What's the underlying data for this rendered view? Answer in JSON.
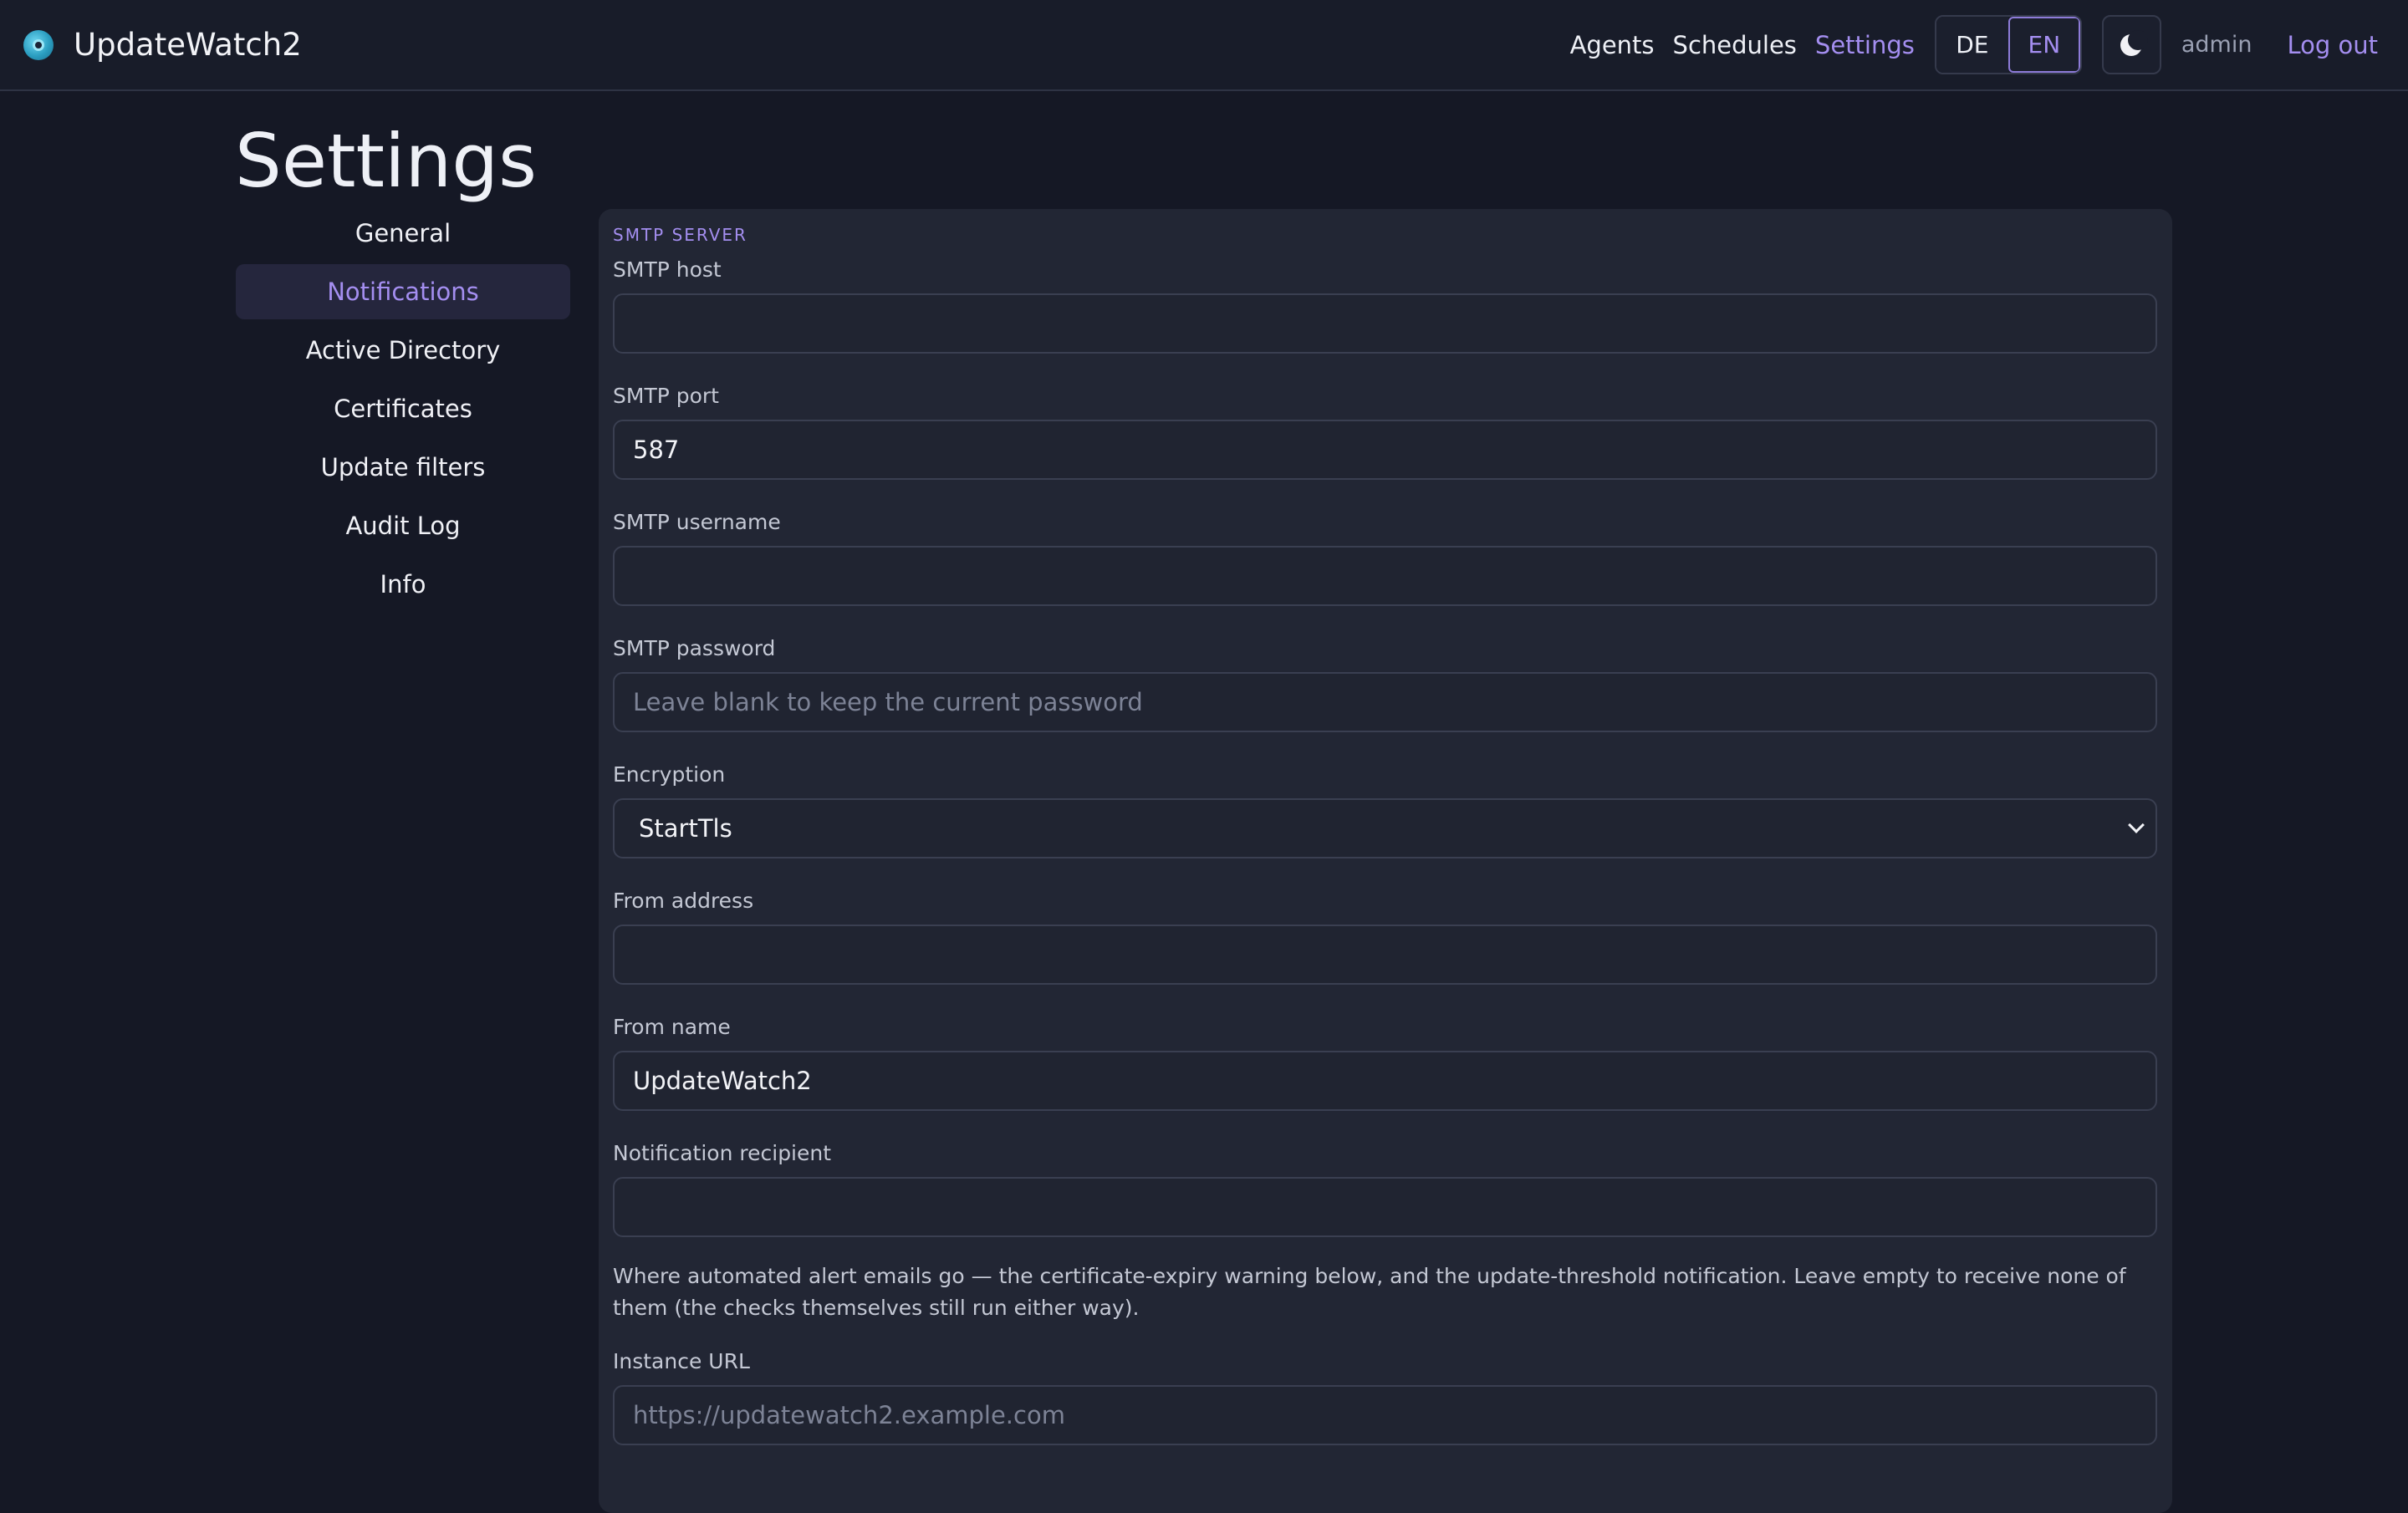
{
  "app": {
    "name": "UpdateWatch2"
  },
  "nav": {
    "links": [
      {
        "label": "Agents",
        "active": false
      },
      {
        "label": "Schedules",
        "active": false
      },
      {
        "label": "Settings",
        "active": true
      }
    ],
    "languages": [
      {
        "label": "DE",
        "active": false
      },
      {
        "label": "EN",
        "active": true
      }
    ],
    "theme_icon": "moon-icon",
    "user": "admin",
    "logout_label": "Log out"
  },
  "page": {
    "title": "Settings"
  },
  "sidebar": {
    "items": [
      {
        "label": "General",
        "active": false
      },
      {
        "label": "Notifications",
        "active": true
      },
      {
        "label": "Active Directory",
        "active": false
      },
      {
        "label": "Certificates",
        "active": false
      },
      {
        "label": "Update filters",
        "active": false
      },
      {
        "label": "Audit Log",
        "active": false
      },
      {
        "label": "Info",
        "active": false
      }
    ]
  },
  "form": {
    "section_label": "SMTP SERVER",
    "smtp_host": {
      "label": "SMTP host",
      "value": "",
      "placeholder": ""
    },
    "smtp_port": {
      "label": "SMTP port",
      "value": "587",
      "placeholder": ""
    },
    "smtp_username": {
      "label": "SMTP username",
      "value": "",
      "placeholder": ""
    },
    "smtp_password": {
      "label": "SMTP password",
      "value": "",
      "placeholder": "Leave blank to keep the current password"
    },
    "encryption": {
      "label": "Encryption",
      "selected": "StartTls"
    },
    "from_address": {
      "label": "From address",
      "value": "",
      "placeholder": ""
    },
    "from_name": {
      "label": "From name",
      "value": "UpdateWatch2",
      "placeholder": ""
    },
    "notification_recipient": {
      "label": "Notification recipient",
      "value": "",
      "placeholder": ""
    },
    "recipient_help": "Where automated alert emails go — the certificate-expiry warning below, and the update-threshold notification. Leave empty to receive none of them (the checks themselves still run either way).",
    "instance_url": {
      "label": "Instance URL",
      "value": "",
      "placeholder": "https://updatewatch2.example.com"
    }
  },
  "colors": {
    "background": "#151825",
    "topbar": "#181c29",
    "panel": "#222634",
    "accent": "#a48ef0"
  }
}
